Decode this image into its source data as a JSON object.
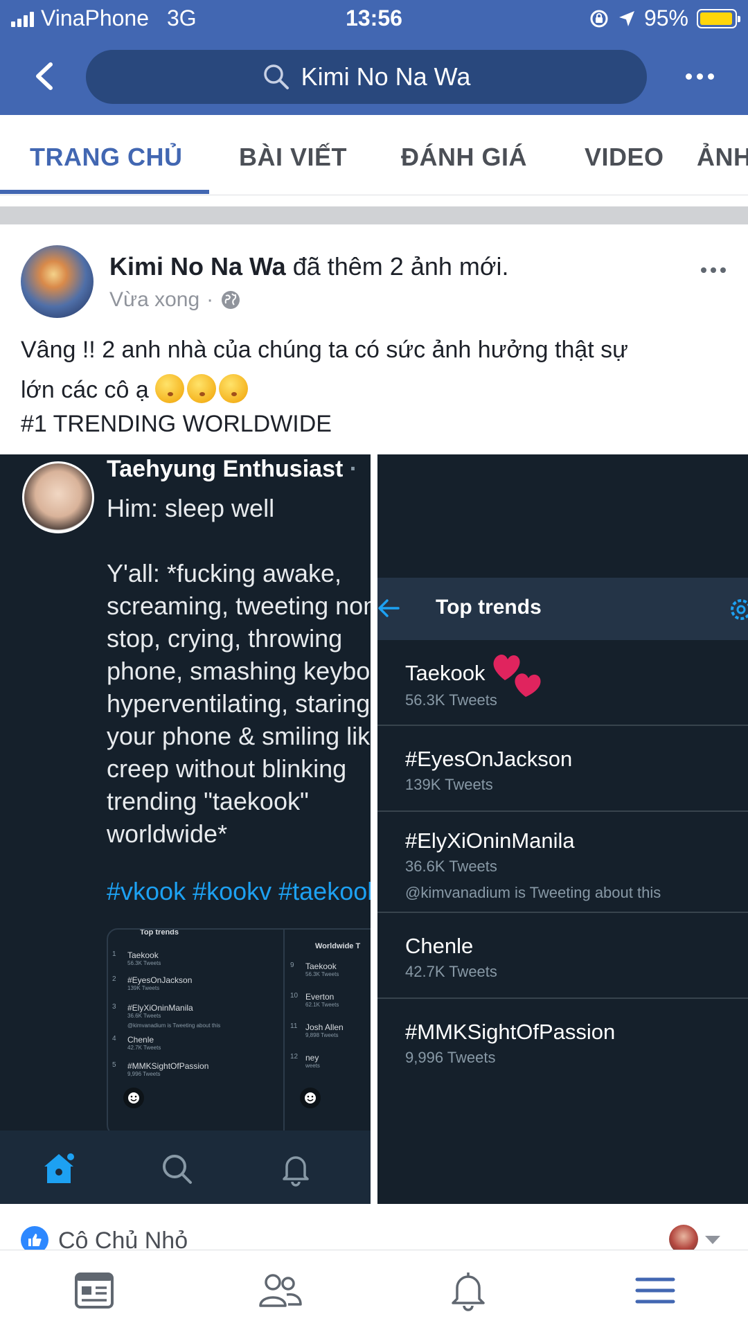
{
  "status_bar": {
    "carrier": "VinaPhone",
    "network": "3G",
    "time": "13:56",
    "battery": "95%",
    "battery_level": 0.95
  },
  "search": {
    "query": "Kimi No Na Wa"
  },
  "tabs": [
    {
      "label": "TRANG CHỦ",
      "active": true
    },
    {
      "label": "BÀI VIẾT",
      "active": false
    },
    {
      "label": "ĐÁNH GIÁ",
      "active": false
    },
    {
      "label": "VIDEO",
      "active": false
    },
    {
      "label": "ẢNH",
      "active": false
    }
  ],
  "post": {
    "author": "Kimi No Na Wa",
    "action": "đã thêm 2 ảnh mới.",
    "time": "Vừa xong",
    "privacy_icon": "globe-icon",
    "text_line1": "Vâng !! 2 anh nhà của chúng ta có sức ảnh hưởng thật sự",
    "text_line2": "lớn các cô ạ",
    "emojis": [
      "kissing-face-emoji",
      "kissing-face-emoji",
      "kissing-face-emoji"
    ],
    "text_line3": "#1 TRENDING WORLDWIDE"
  },
  "tweet": {
    "name": "Taehyung Enthusiast",
    "separator": "·",
    "text": "Him: sleep well\n\nY'all: *fucking awake,\nscreaming, tweeting non\nstop, crying, throwing\nphone, smashing keyboard\nhyperventilating, staring at\nyour phone & smiling like a\ncreep without blinking\ntrending \"taekook\"\nworldwide*",
    "hashtags": "#vkook #kookv #taekook",
    "embedded": {
      "left_header": "Top trends",
      "left_items": [
        {
          "num": "1",
          "title": "Taekook",
          "sub": "56.3K Tweets"
        },
        {
          "num": "2",
          "title": "#EyesOnJackson",
          "sub": "139K Tweets"
        },
        {
          "num": "3",
          "title": "#ElyXiOninManila",
          "sub": "36.6K Tweets"
        },
        {
          "num": "",
          "title": "",
          "sub": "@kimvanadium is Tweeting about this"
        },
        {
          "num": "4",
          "title": "Chenle",
          "sub": "42.7K Tweets"
        },
        {
          "num": "5",
          "title": "#MMKSightOfPassion",
          "sub": "9,996 Tweets"
        }
      ],
      "right_header": "Worldwide T",
      "right_items": [
        {
          "num": "9",
          "title": "Taekook",
          "sub": "56.3K Tweets"
        },
        {
          "num": "10",
          "title": "Everton",
          "sub": "62.1K Tweets"
        },
        {
          "num": "11",
          "title": "Josh Allen",
          "sub": "9,898 Tweets"
        },
        {
          "num": "12",
          "title": "ney",
          "sub": "weets"
        }
      ]
    }
  },
  "trends": {
    "title": "Top trends",
    "items": [
      {
        "name": "Taekook",
        "count": "56.3K Tweets",
        "extra": ""
      },
      {
        "name": "#EyesOnJackson",
        "count": "139K Tweets",
        "extra": ""
      },
      {
        "name": "#ElyXiOninManila",
        "count": "36.6K Tweets",
        "extra": "@kimvanadium is Tweeting about this"
      },
      {
        "name": "Chenle",
        "count": "42.7K Tweets",
        "extra": ""
      },
      {
        "name": "#MMKSightOfPassion",
        "count": "9,996 Tweets",
        "extra": ""
      }
    ]
  },
  "reaction": {
    "name": "Cô Chủ Nhỏ"
  },
  "colors": {
    "facebook_blue": "#4267b2",
    "search_bg": "#29487d",
    "twitter_bg": "#15202b",
    "twitter_blue": "#1da1f2",
    "heart_pink": "#e0245e"
  }
}
